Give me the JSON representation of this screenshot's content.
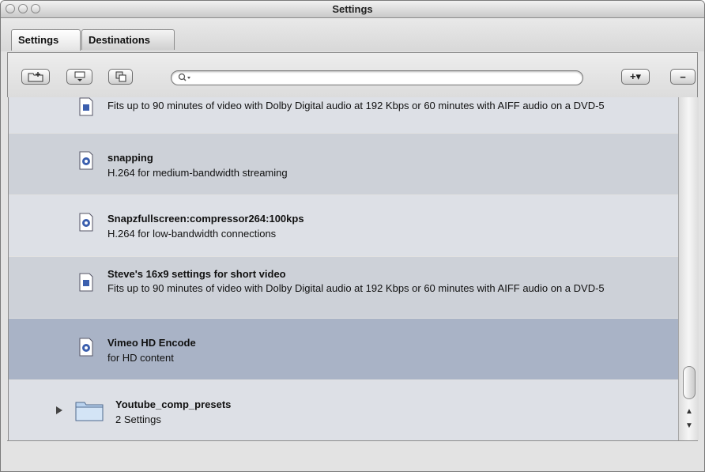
{
  "window": {
    "title": "Settings"
  },
  "tabs": [
    {
      "label": "Settings",
      "active": true
    },
    {
      "label": "Destinations",
      "active": false
    }
  ],
  "toolbar": {
    "buttons": [
      {
        "icon": "new-folder-icon"
      },
      {
        "icon": "new-setting-icon"
      },
      {
        "icon": "duplicate-icon"
      }
    ],
    "search_icon": "search-icon",
    "search_value": "",
    "add_label": "+▾",
    "remove_label": "−"
  },
  "list": {
    "items": [
      {
        "icon": "document-icon",
        "name": "",
        "desc": "Fits up to 90 minutes of video with Dolby Digital audio at 192 Kbps or 60 minutes with AIFF audio on a DVD-5",
        "selected": false
      },
      {
        "icon": "quicktime-document-icon",
        "name": "snapping",
        "desc": "H.264 for medium-bandwidth streaming",
        "selected": false
      },
      {
        "icon": "quicktime-document-icon",
        "name": "Snapzfullscreen:compressor264:100kps",
        "desc": "H.264 for low-bandwidth connections",
        "selected": false
      },
      {
        "icon": "document-icon",
        "name": "Steve's 16x9  settings for short video",
        "desc": "Fits up to 90 minutes of video with Dolby Digital audio at 192 Kbps or 60 minutes with AIFF audio on a DVD-5",
        "selected": false
      },
      {
        "icon": "quicktime-document-icon",
        "name": "Vimeo HD Encode",
        "desc": "for HD content",
        "selected": true
      },
      {
        "icon": "folder-icon",
        "name": "Youtube_comp_presets",
        "desc": "2 Settings",
        "selected": false
      }
    ]
  },
  "colors": {
    "row_odd": "#dde0e6",
    "row_even": "#cdd1d8",
    "row_selected": "#a9b3c6"
  }
}
